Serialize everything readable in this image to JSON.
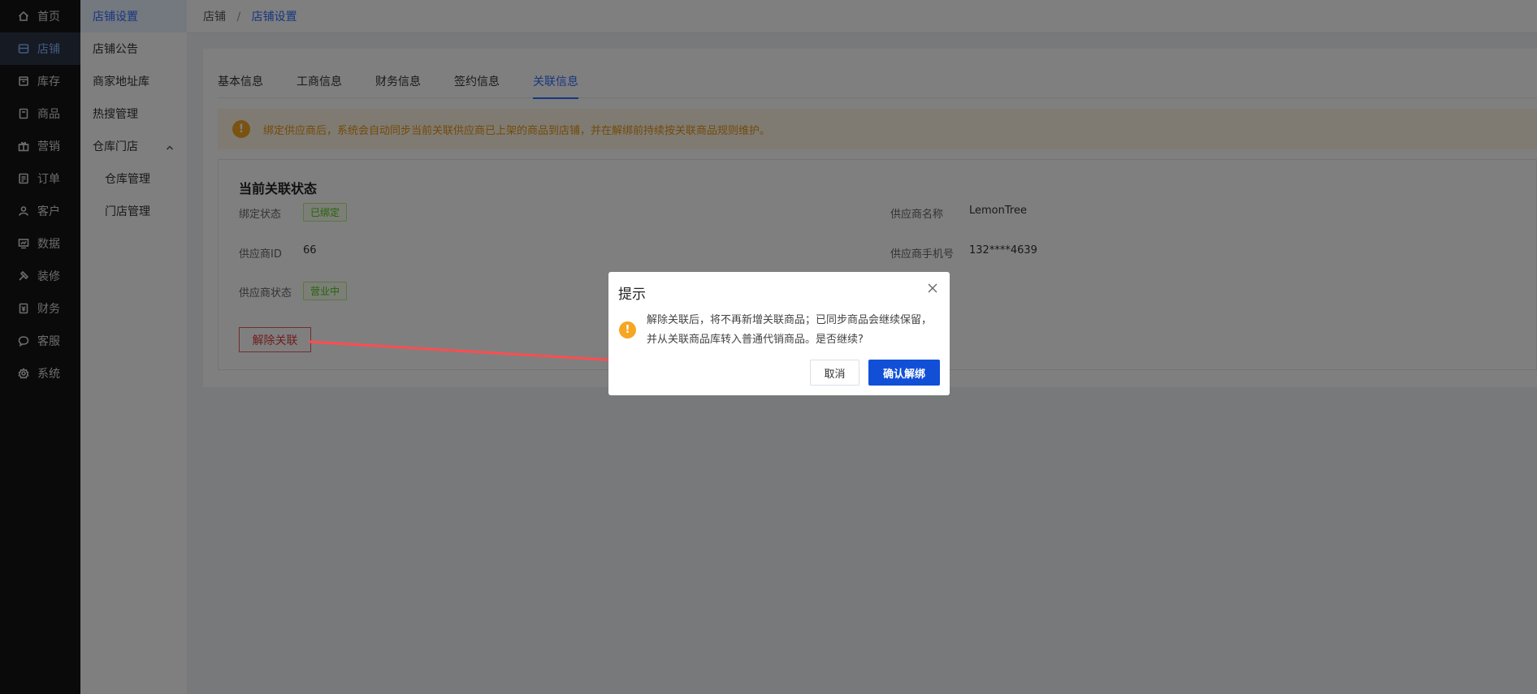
{
  "nav": {
    "items": [
      {
        "label": "首页",
        "icon": "home-icon"
      },
      {
        "label": "店铺",
        "icon": "store-icon"
      },
      {
        "label": "库存",
        "icon": "inventory-icon"
      },
      {
        "label": "商品",
        "icon": "product-icon"
      },
      {
        "label": "营销",
        "icon": "gift-icon"
      },
      {
        "label": "订单",
        "icon": "order-icon"
      },
      {
        "label": "客户",
        "icon": "user-icon"
      },
      {
        "label": "数据",
        "icon": "chart-icon"
      },
      {
        "label": "装修",
        "icon": "design-icon"
      },
      {
        "label": "财务",
        "icon": "finance-icon"
      },
      {
        "label": "客服",
        "icon": "chat-icon"
      },
      {
        "label": "系统",
        "icon": "gear-icon"
      }
    ],
    "active_index": 1
  },
  "subnav": {
    "items": [
      {
        "label": "店铺设置"
      },
      {
        "label": "店铺公告"
      },
      {
        "label": "商家地址库"
      },
      {
        "label": "热搜管理"
      },
      {
        "label": "仓库门店"
      },
      {
        "label": "仓库管理"
      },
      {
        "label": "门店管理"
      }
    ]
  },
  "breadcrumb": {
    "root": "店铺",
    "sep": "/",
    "current": "店铺设置"
  },
  "tabs": [
    {
      "label": "基本信息"
    },
    {
      "label": "工商信息"
    },
    {
      "label": "财务信息"
    },
    {
      "label": "签约信息"
    },
    {
      "label": "关联信息"
    }
  ],
  "alert": {
    "icon": "!",
    "text": "绑定供应商后，系统会自动同步当前关联供应商已上架的商品到店铺，并在解绑前持续按关联商品规则维护。"
  },
  "status": {
    "title": "当前关联状态",
    "bind_label": "绑定状态",
    "bind_value": "已绑定",
    "supplier_id_label": "供应商ID",
    "supplier_id_value": "66",
    "supplier_status_label": "供应商状态",
    "supplier_status_value": "营业中",
    "supplier_name_label": "供应商名称",
    "supplier_name_value": "LemonTree",
    "supplier_phone_label": "供应商手机号",
    "supplier_phone_value": "132****4639",
    "unbind_button": "解除关联"
  },
  "dialog": {
    "title": "提示",
    "icon": "!",
    "message": "解除关联后，将不再新增关联商品；已同步商品会继续保留，并从关联商品库转入普通代销商品。是否继续?",
    "cancel": "取消",
    "confirm": "确认解绑"
  },
  "colors": {
    "primary": "#1150d6",
    "accent": "#2f6fff",
    "warning": "#f5a623",
    "danger": "#e03c3c",
    "arrow": "#ff4d4f"
  }
}
